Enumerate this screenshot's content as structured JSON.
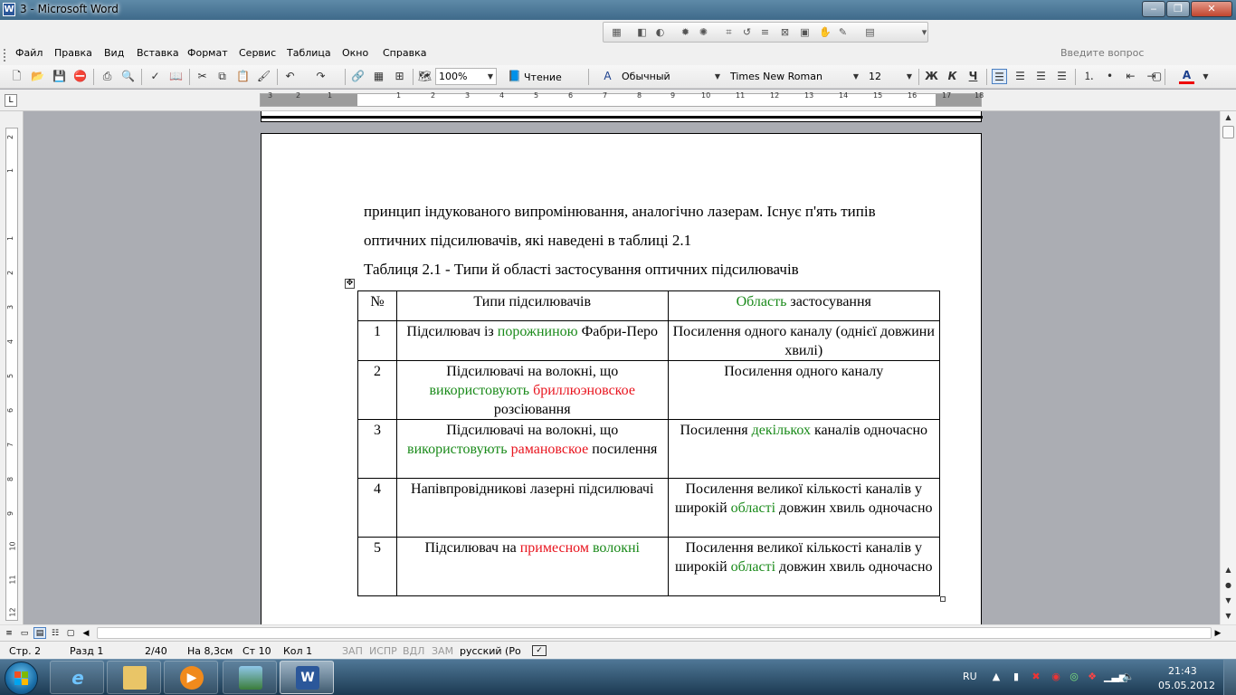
{
  "window": {
    "title": "3 - Microsoft Word",
    "app_icon": "W"
  },
  "menu": {
    "items": [
      "Файл",
      "Правка",
      "Вид",
      "Вставка",
      "Формат",
      "Сервис",
      "Таблица",
      "Окно",
      "Справка"
    ],
    "ask_placeholder": "Введите вопрос"
  },
  "toolbar": {
    "zoom": "100%",
    "read_label": "Чтение",
    "style": "Обычный",
    "font": "Times New Roman",
    "size": "12",
    "bold": "Ж",
    "italic": "К",
    "underline": "Ч"
  },
  "ruler": {
    "h_labels": [
      "3",
      "2",
      "1",
      "1",
      "2",
      "3",
      "4",
      "5",
      "6",
      "7",
      "8",
      "9",
      "10",
      "11",
      "12",
      "13",
      "14",
      "15",
      "16",
      "17",
      "18"
    ],
    "v_labels": [
      "2",
      "1",
      "1",
      "2",
      "3",
      "4",
      "5",
      "6",
      "7",
      "8",
      "9",
      "10",
      "11",
      "12"
    ]
  },
  "document": {
    "paragraph_line1": "принцип індукованого випромінювання, аналогічно лазерам. Існує п'ять типів",
    "paragraph_line2": "оптичних підсилювачів, які наведені в таблиці 2.1",
    "caption": "Таблиця 2.1 - Типи й області застосування оптичних підсилювачів",
    "table": {
      "header": {
        "num": "№",
        "type": "Типи підсилювачів",
        "area_a": "Область",
        "area_b": " застосування"
      },
      "rows": [
        {
          "num": "1",
          "type_a": "Підсилювач із ",
          "type_b": "порожниною",
          "type_c": " Фабри-Перо",
          "area_a": "Посилення одного каналу (однієї довжини хвилі)"
        },
        {
          "num": "2",
          "type_a": "Підсилювачі на волокні, що ",
          "type_b": "використовують",
          "type_c": " ",
          "type_d": "бриллюэновское",
          "type_e": " розсіювання",
          "area_a": "Посилення одного каналу"
        },
        {
          "num": "3",
          "type_a": "Підсилювачі на волокні, що ",
          "type_b": "використовують",
          "type_c": " ",
          "type_d": "рамановское",
          "type_e": " посилення",
          "area_a": "Посилення ",
          "area_b": "декількох",
          "area_c": " каналів одночасно"
        },
        {
          "num": "4",
          "type_a": "Напівпровідникові лазерні підсилювачі",
          "area_a": "Посилення великої кількості каналів у широкій ",
          "area_b": "області",
          "area_c": " довжин хвиль одночасно"
        },
        {
          "num": "5",
          "type_a": "Підсилювач на ",
          "type_d": "примесном",
          "type_c": " ",
          "type_b": "волокні",
          "area_a": "Посилення великої кількості каналів у широкій ",
          "area_b": "області",
          "area_c": " довжин хвиль одночасно"
        }
      ]
    }
  },
  "status": {
    "page": "Стр. 2",
    "section": "Разд 1",
    "pages": "2/40",
    "at": "На 8,3см",
    "line": "Ст 10",
    "col": "Кол 1",
    "rec": "ЗАП",
    "trk": "ИСПР",
    "ext": "ВДЛ",
    "ovr": "ЗАМ",
    "lang": "русский (Ро"
  },
  "taskbar": {
    "lang": "RU",
    "time": "21:43",
    "date": "05.05.2012"
  },
  "colors": {
    "green": "#1a8a1a",
    "red": "#e8141e"
  }
}
